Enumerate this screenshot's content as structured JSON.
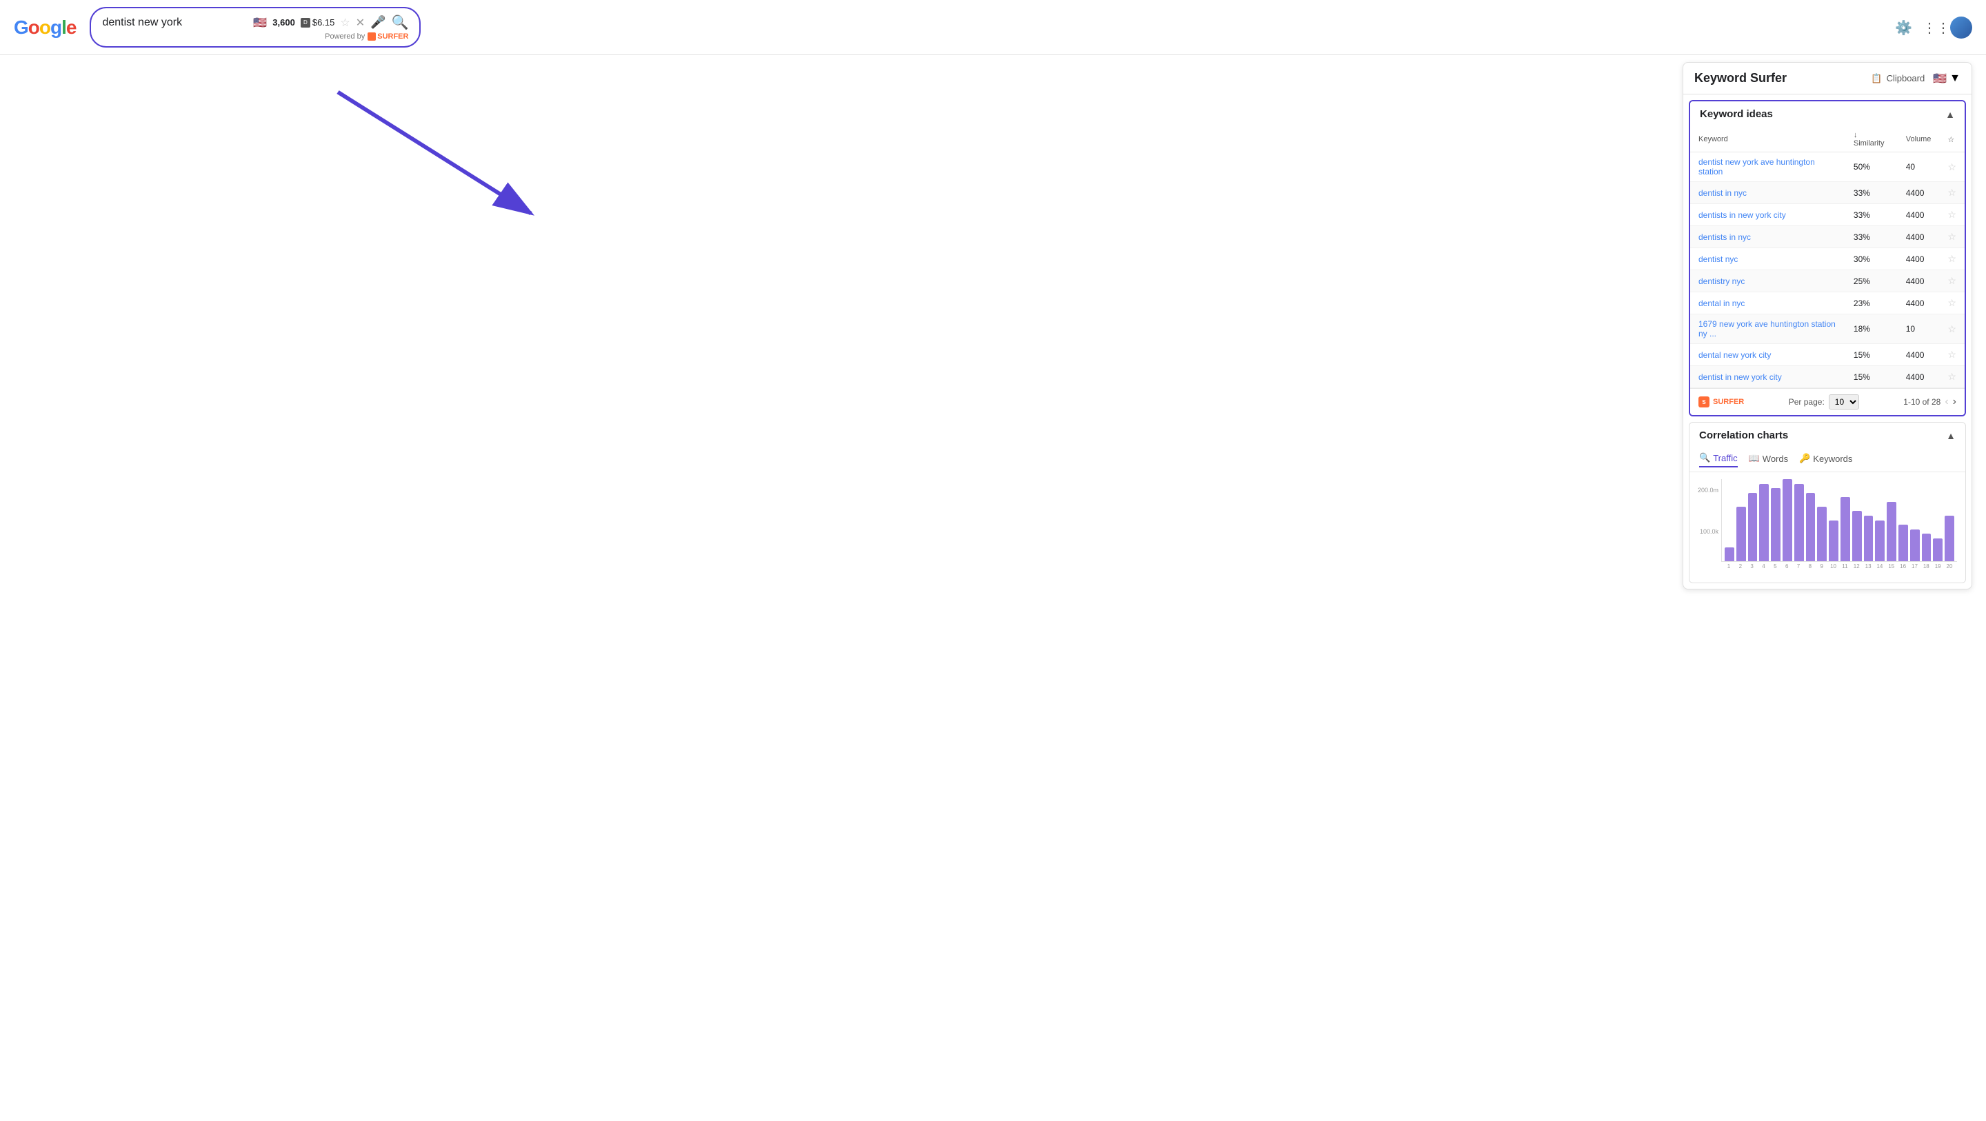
{
  "header": {
    "logo": "Google",
    "search_query": "dentist new york",
    "volume": "3,600",
    "cpc": "$6.15",
    "powered_by": "Powered by",
    "surfer_brand": "SURFER"
  },
  "panel": {
    "title": "Keyword Surfer",
    "clipboard_label": "Clipboard",
    "flag": "🇺🇸",
    "keyword_ideas": {
      "section_title": "Keyword ideas",
      "columns": {
        "keyword": "Keyword",
        "similarity": "Similarity",
        "volume": "Volume"
      },
      "rows": [
        {
          "keyword": "dentist new york ave huntington station",
          "similarity": "50%",
          "volume": "40"
        },
        {
          "keyword": "dentist in nyc",
          "similarity": "33%",
          "volume": "4400"
        },
        {
          "keyword": "dentists in new york city",
          "similarity": "33%",
          "volume": "4400"
        },
        {
          "keyword": "dentists in nyc",
          "similarity": "33%",
          "volume": "4400"
        },
        {
          "keyword": "dentist nyc",
          "similarity": "30%",
          "volume": "4400"
        },
        {
          "keyword": "dentistry nyc",
          "similarity": "25%",
          "volume": "4400"
        },
        {
          "keyword": "dental in nyc",
          "similarity": "23%",
          "volume": "4400"
        },
        {
          "keyword": "1679 new york ave huntington station ny ...",
          "similarity": "18%",
          "volume": "10"
        },
        {
          "keyword": "dental new york city",
          "similarity": "15%",
          "volume": "4400"
        },
        {
          "keyword": "dentist in new york city",
          "similarity": "15%",
          "volume": "4400"
        }
      ],
      "per_page_label": "Per page:",
      "per_page_value": "10",
      "pagination_text": "1-10 of 28"
    },
    "correlation_charts": {
      "section_title": "Correlation charts",
      "tabs": [
        {
          "label": "Traffic",
          "icon": "🔍",
          "active": true
        },
        {
          "label": "Words",
          "icon": "📖",
          "active": false
        },
        {
          "label": "Keywords",
          "icon": "🔑",
          "active": false
        }
      ],
      "y_labels": [
        "200.0m",
        "100.0k"
      ],
      "x_labels": [
        "1",
        "2",
        "3",
        "4",
        "5",
        "6",
        "7",
        "8",
        "9",
        "10",
        "11",
        "12",
        "13",
        "14",
        "15",
        "16",
        "17",
        "18",
        "19",
        "20"
      ],
      "bars": [
        15,
        60,
        75,
        85,
        80,
        90,
        85,
        75,
        60,
        45,
        70,
        55,
        50,
        45,
        65,
        40,
        35,
        30,
        25,
        50
      ]
    }
  }
}
